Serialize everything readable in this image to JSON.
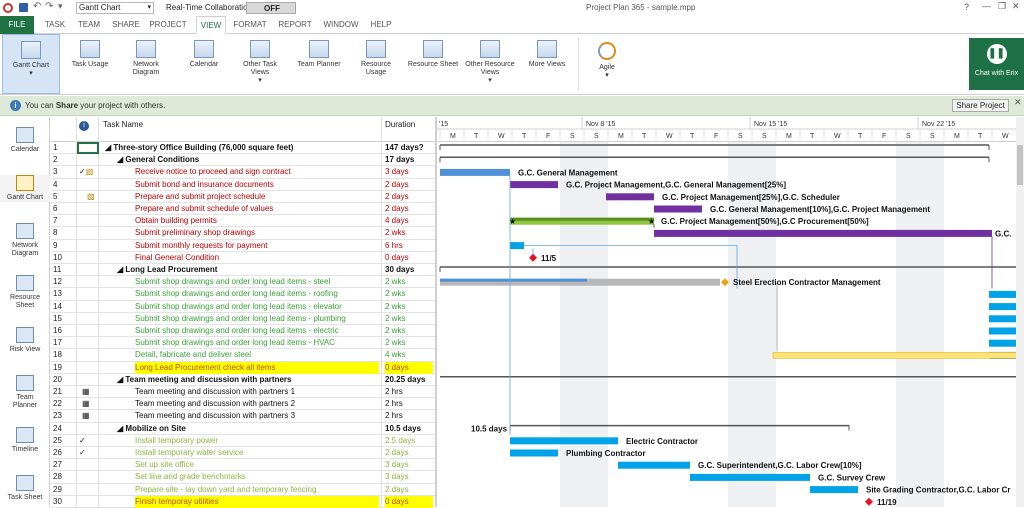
{
  "window": {
    "title": "Project Plan 365 - sample.mpp",
    "view_selector": "Gantt Chart",
    "collab_label": "Real-Time Collaboration",
    "collab_state": "OFF",
    "help": "?"
  },
  "tabs": [
    "FILE",
    "TASK",
    "TEAM",
    "SHARE",
    "PROJECT",
    "VIEW",
    "FORMAT",
    "REPORT",
    "WINDOW",
    "HELP"
  ],
  "ribbon": [
    "Gantt Chart",
    "Task Usage",
    "Network Diagram",
    "Calendar",
    "Other Task Views",
    "Team Planner",
    "Resource Usage",
    "Resource Sheet",
    "Other Resource Views",
    "More Views",
    "Agile",
    "Chat with Erix"
  ],
  "infobar": {
    "pre": "You can ",
    "bold": "Share",
    "post": " your project with others.",
    "button": "Share Project"
  },
  "side_views": [
    "Calendar",
    "Gantt Chart",
    "Network Diagram",
    "Resource Sheet",
    "Risk View",
    "Team Planner",
    "Timeline",
    "Task Sheet"
  ],
  "grid_headers": {
    "info": "i",
    "name": "Task Name",
    "duration": "Duration"
  },
  "timeline": {
    "weeks": [
      "'15",
      "Nov 8 '15",
      "Nov 15 '15",
      "Nov 22 '15"
    ],
    "days": [
      "M",
      "T",
      "W",
      "T",
      "F",
      "S",
      "S",
      "M",
      "T",
      "W",
      "T",
      "F",
      "S",
      "S",
      "M",
      "T",
      "W",
      "T",
      "F",
      "S",
      "S",
      "M",
      "T",
      "W"
    ]
  },
  "tasks": [
    {
      "id": "1",
      "name": "Three-story Office Building (76,000 square feet)",
      "dur": "147 days?",
      "lvl": 0,
      "sum": true,
      "color": "#111",
      "bg": ""
    },
    {
      "id": "2",
      "name": "General Conditions",
      "dur": "17 days",
      "lvl": 1,
      "sum": true,
      "color": "#111",
      "bg": ""
    },
    {
      "id": "3",
      "name": "Receive notice to proceed and sign contract",
      "dur": "3 days",
      "lvl": 2,
      "sum": false,
      "color": "#c00000",
      "bg": "",
      "ind": "check-note"
    },
    {
      "id": "4",
      "name": "Submit bond and insurance documents",
      "dur": "2 days",
      "lvl": 2,
      "sum": false,
      "color": "#c00000",
      "bg": ""
    },
    {
      "id": "5",
      "name": "Prepare and submit project schedule",
      "dur": "2 days",
      "lvl": 2,
      "sum": false,
      "color": "#c00000",
      "bg": "",
      "ind": "note"
    },
    {
      "id": "6",
      "name": "Prepare and submit schedule of values",
      "dur": "2 days",
      "lvl": 2,
      "sum": false,
      "color": "#c00000",
      "bg": ""
    },
    {
      "id": "7",
      "name": "Obtain building permits",
      "dur": "4 days",
      "lvl": 2,
      "sum": false,
      "color": "#c00000",
      "bg": ""
    },
    {
      "id": "8",
      "name": "Submit preliminary shop drawings",
      "dur": "2 wks",
      "lvl": 2,
      "sum": false,
      "color": "#c00000",
      "bg": ""
    },
    {
      "id": "9",
      "name": "Submit monthly requests for payment",
      "dur": "6 hrs",
      "lvl": 2,
      "sum": false,
      "color": "#c00000",
      "bg": ""
    },
    {
      "id": "10",
      "name": "Final General Condition",
      "dur": "0 days",
      "lvl": 2,
      "sum": false,
      "color": "#c00000",
      "bg": ""
    },
    {
      "id": "11",
      "name": "Long Lead Procurement",
      "dur": "30 days",
      "lvl": 1,
      "sum": true,
      "color": "#111",
      "bg": ""
    },
    {
      "id": "12",
      "name": "Submit shop drawings and order long lead items - steel",
      "dur": "2 wks",
      "lvl": 2,
      "sum": false,
      "color": "#3aa33a",
      "bg": ""
    },
    {
      "id": "13",
      "name": "Submit shop drawings and order long lead items - roofing",
      "dur": "2 wks",
      "lvl": 2,
      "sum": false,
      "color": "#3aa33a",
      "bg": ""
    },
    {
      "id": "14",
      "name": "Submit shop drawings and order long lead items - elevator",
      "dur": "2 wks",
      "lvl": 2,
      "sum": false,
      "color": "#3aa33a",
      "bg": ""
    },
    {
      "id": "15",
      "name": "Submit shop drawings and order long lead items - plumbing",
      "dur": "2 wks",
      "lvl": 2,
      "sum": false,
      "color": "#3aa33a",
      "bg": ""
    },
    {
      "id": "16",
      "name": "Submit shop drawings and order long lead items - electric",
      "dur": "2 wks",
      "lvl": 2,
      "sum": false,
      "color": "#3aa33a",
      "bg": ""
    },
    {
      "id": "17",
      "name": "Submit shop drawings and order long lead items - HVAC",
      "dur": "2 wks",
      "lvl": 2,
      "sum": false,
      "color": "#3aa33a",
      "bg": ""
    },
    {
      "id": "18",
      "name": "Detail, fabricate and deliver steel",
      "dur": "4 wks",
      "lvl": 2,
      "sum": false,
      "color": "#3aa33a",
      "bg": ""
    },
    {
      "id": "19",
      "name": "Long Lead Procurement check all items",
      "dur": "0 days",
      "lvl": 2,
      "sum": false,
      "color": "#c05000",
      "bg": "#ffff00"
    },
    {
      "id": "20",
      "name": "Team meeting and discussion with partners",
      "dur": "20.25 days",
      "lvl": 1,
      "sum": true,
      "color": "#111",
      "bg": ""
    },
    {
      "id": "21",
      "name": "Team meeting and discussion with partners 1",
      "dur": "2 hrs",
      "lvl": 2,
      "sum": false,
      "color": "#111",
      "bg": "",
      "ind": "cal"
    },
    {
      "id": "22",
      "name": "Team meeting and discussion with partners 2",
      "dur": "2 hrs",
      "lvl": 2,
      "sum": false,
      "color": "#111",
      "bg": "",
      "ind": "cal"
    },
    {
      "id": "23",
      "name": "Team meeting and discussion with partners 3",
      "dur": "2 hrs",
      "lvl": 2,
      "sum": false,
      "color": "#111",
      "bg": "",
      "ind": "cal"
    },
    {
      "id": "24",
      "name": "Mobilize on Site",
      "dur": "10.5 days",
      "lvl": 1,
      "sum": true,
      "color": "#111",
      "bg": ""
    },
    {
      "id": "25",
      "name": "Install temporary power",
      "dur": "2.5 days",
      "lvl": 2,
      "sum": false,
      "color": "#8ab840",
      "bg": "",
      "ind": "check"
    },
    {
      "id": "26",
      "name": "Install temporary water service",
      "dur": "2 days",
      "lvl": 2,
      "sum": false,
      "color": "#8ab840",
      "bg": "",
      "ind": "check"
    },
    {
      "id": "27",
      "name": "Set up site office",
      "dur": "3 days",
      "lvl": 2,
      "sum": false,
      "color": "#8ab840",
      "bg": ""
    },
    {
      "id": "28",
      "name": "Set line and grade benchmarks",
      "dur": "3 days",
      "lvl": 2,
      "sum": false,
      "color": "#8ab840",
      "bg": ""
    },
    {
      "id": "29",
      "name": "Prepare site - lay down yard and temporary fencing",
      "dur": "2 days",
      "lvl": 2,
      "sum": false,
      "color": "#8ab840",
      "bg": ""
    },
    {
      "id": "30",
      "name": "Finish temporay utilities",
      "dur": "0 days",
      "lvl": 2,
      "sum": false,
      "color": "#c05000",
      "bg": "#ffff00"
    }
  ],
  "gantt_labels": [
    "G.C. General Management",
    "G.C. Project Management,G.C. General Management[25%]",
    "G.C. Project Management[25%],G.C. Scheduler",
    "G.C. General Management[10%],G.C. Project Management",
    "G.C. Project Management[50%],G.C Procurement[50%]",
    "G.C.",
    "11/5",
    "Steel Erection Contractor Management",
    "10.5 days",
    "Electric Contractor",
    "Plumbing Contractor",
    "G.C. Superintendent,G.C. Labor Crew[10%]",
    "G.C. Survey Crew",
    "Site Grading Contractor,G.C. Labor Cr",
    "11/19"
  ],
  "colors": {
    "accent": "#217346",
    "view_tab": "#1e7145",
    "summary": "#333333",
    "critical": "#7030a0",
    "normal": "#00a2e8",
    "green_bar": "#8dc63f",
    "milestone": "#e81123"
  }
}
